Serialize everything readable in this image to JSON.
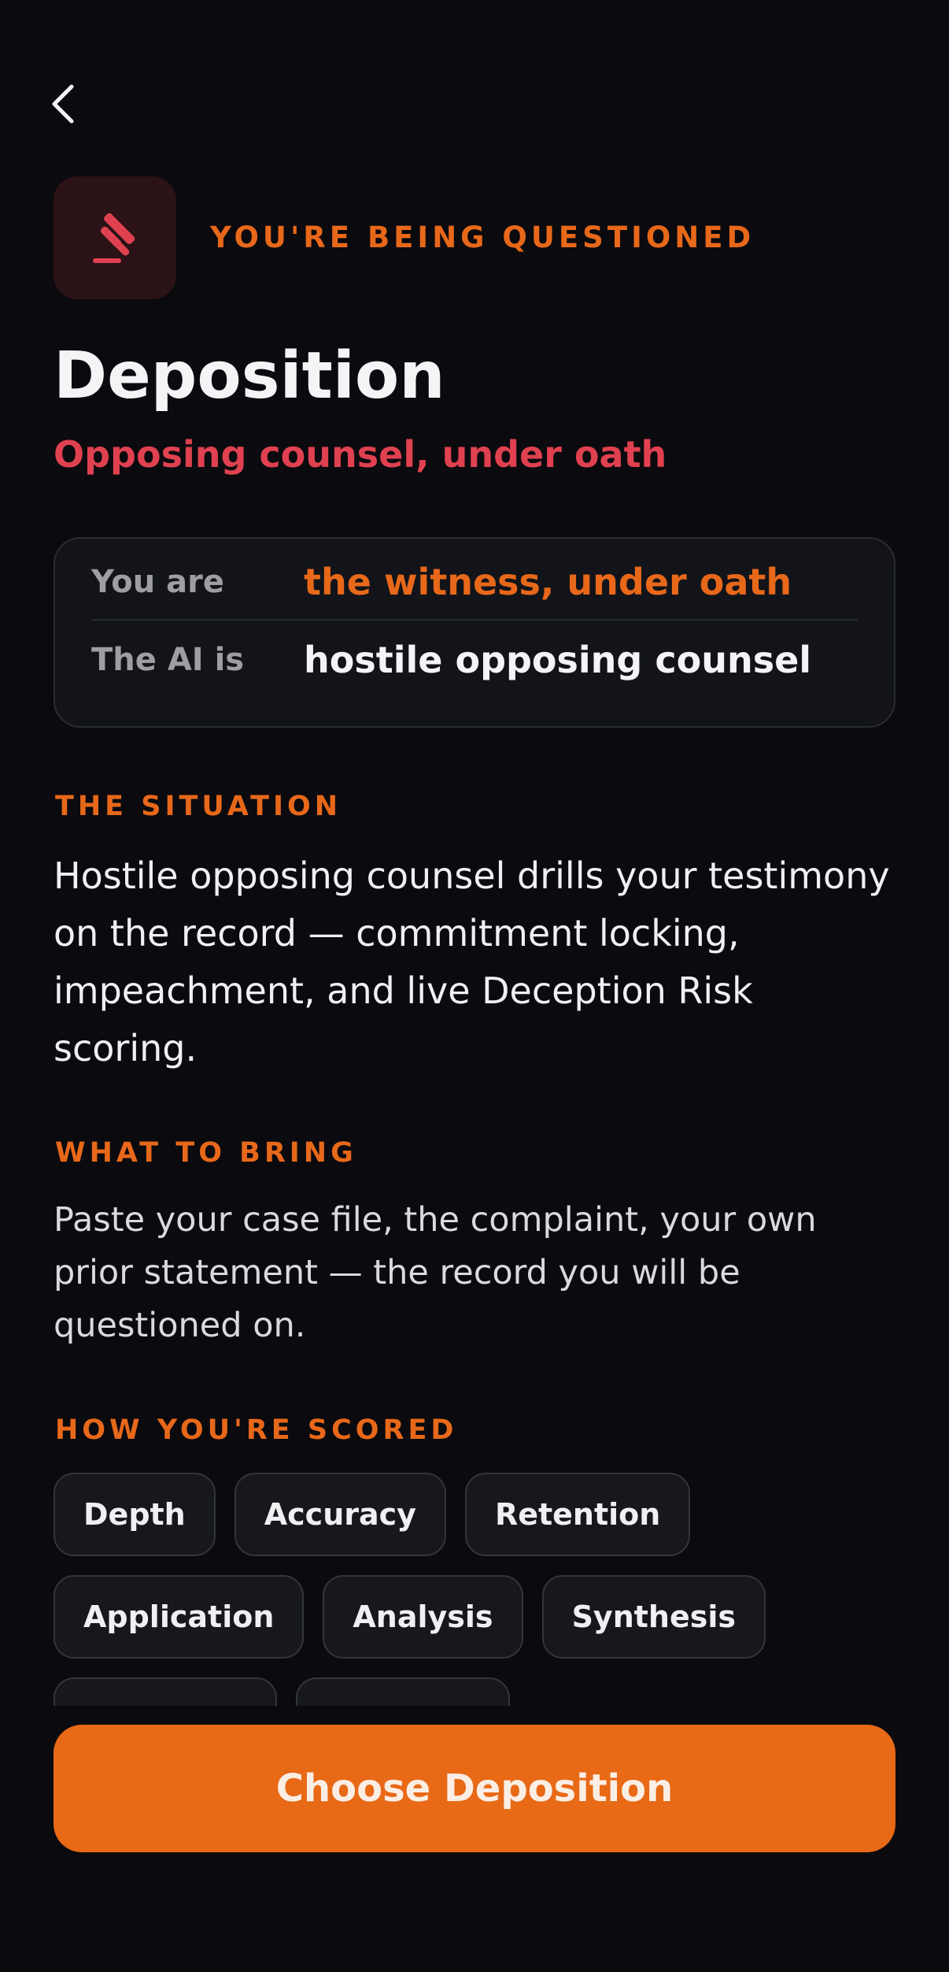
{
  "header": {
    "back_icon": "chevron-left-icon",
    "badge_icon": "gavel-icon",
    "eyebrow": "YOU'RE BEING QUESTIONED",
    "title": "Deposition",
    "subtitle": "Opposing counsel, under oath"
  },
  "roles": {
    "you_label": "You are",
    "you_value": "the witness, under oath",
    "ai_label": "The AI is",
    "ai_value": "hostile opposing counsel"
  },
  "situation": {
    "label": "THE SITUATION",
    "text": "Hostile opposing counsel drills your testimony on the record — commitment locking, impeachment, and live Deception Risk scoring."
  },
  "bring": {
    "label": "WHAT TO BRING",
    "text": "Paste your case file, the complaint, your own prior statement — the record you will be questioned on."
  },
  "scoring": {
    "label": "HOW YOU'RE SCORED",
    "chips": [
      "Depth",
      "Accuracy",
      "Retention",
      "Application",
      "Analysis",
      "Synthesis"
    ]
  },
  "cta": {
    "label": "Choose Deposition"
  },
  "colors": {
    "background": "#0b0a0e",
    "accent": "#e8681a",
    "danger": "#e04150",
    "card": "#121419"
  }
}
